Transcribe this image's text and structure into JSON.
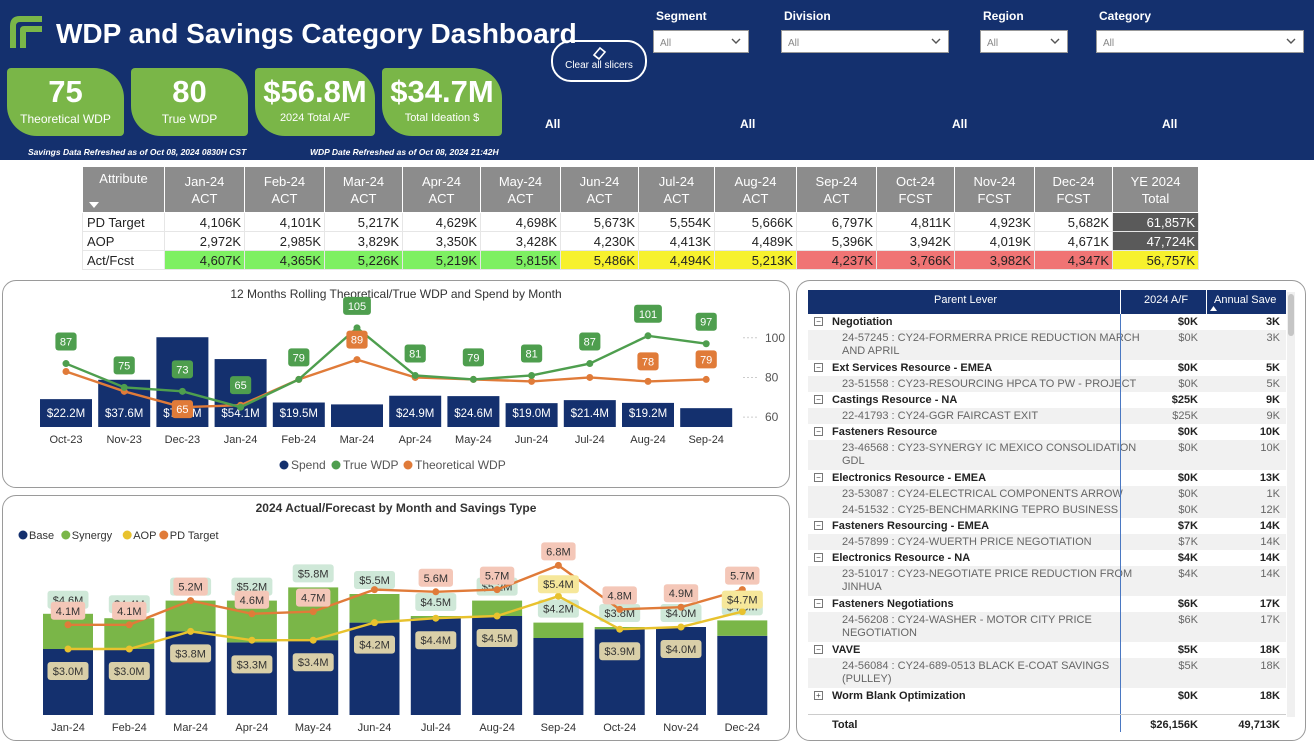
{
  "header": {
    "title": "WDP and Savings Category Dashboard",
    "clear_slicers_label": "Clear all slicers",
    "savings_refresh": "Savings Data Refreshed as of Oct 08, 2024 0830H CST",
    "wdp_refresh": "WDP Date Refreshed as of Oct 08, 2024 21:42H",
    "colors": {
      "header_bg": "#14306e",
      "kpi_green": "#7ab648"
    }
  },
  "kpis": [
    {
      "value": "75",
      "label": "Theoretical WDP"
    },
    {
      "value": "80",
      "label": "True WDP"
    },
    {
      "value": "$56.8M",
      "label": "2024 Total A/F"
    },
    {
      "value": "$34.7M",
      "label": "Total Ideation $"
    }
  ],
  "slicers": [
    {
      "label": "Segment",
      "value": "All",
      "selected": "All"
    },
    {
      "label": "Division",
      "value": "All",
      "selected": "All"
    },
    {
      "label": "Region",
      "value": "All",
      "selected": "All"
    },
    {
      "label": "Category",
      "value": "All",
      "selected": "All"
    }
  ],
  "matrix": {
    "attr_header": "Attribute",
    "columns": [
      [
        "Jan-24",
        "ACT"
      ],
      [
        "Feb-24",
        "ACT"
      ],
      [
        "Mar-24",
        "ACT"
      ],
      [
        "Apr-24",
        "ACT"
      ],
      [
        "May-24",
        "ACT"
      ],
      [
        "Jun-24",
        "ACT"
      ],
      [
        "Jul-24",
        "ACT"
      ],
      [
        "Aug-24",
        "ACT"
      ],
      [
        "Sep-24",
        "ACT"
      ],
      [
        "Oct-24",
        "FCST"
      ],
      [
        "Nov-24",
        "FCST"
      ],
      [
        "Dec-24",
        "FCST"
      ],
      [
        "YE 2024",
        "Total"
      ]
    ],
    "rows": [
      {
        "label": "PD Target",
        "values": [
          "4,106K",
          "4,101K",
          "5,217K",
          "4,629K",
          "4,698K",
          "5,673K",
          "5,554K",
          "5,666K",
          "6,797K",
          "4,811K",
          "4,923K",
          "5,682K",
          "61,857K"
        ]
      },
      {
        "label": "AOP",
        "values": [
          "2,972K",
          "2,985K",
          "3,829K",
          "3,350K",
          "3,428K",
          "4,230K",
          "4,413K",
          "4,489K",
          "5,396K",
          "3,942K",
          "4,019K",
          "4,671K",
          "47,724K"
        ]
      },
      {
        "label": "Act/Fcst",
        "values": [
          "4,607K",
          "4,365K",
          "5,226K",
          "5,219K",
          "5,815K",
          "5,486K",
          "4,494K",
          "5,213K",
          "4,237K",
          "3,766K",
          "3,982K",
          "4,347K",
          "56,757K"
        ]
      }
    ],
    "status_colors": {
      "green": "#7ef062",
      "yellow": "#f7f12d",
      "red": "#f07474",
      "total_bg": "#5a5a5a"
    }
  },
  "chart_data": [
    {
      "type": "bar",
      "title": "12 Months Rolling Theoretical/True WDP and Spend by Month",
      "categories": [
        "Oct-23",
        "Nov-23",
        "Dec-23",
        "Jan-24",
        "Feb-24",
        "Mar-24",
        "Apr-24",
        "May-24",
        "Jun-24",
        "Jul-24",
        "Aug-24",
        "Sep-24"
      ],
      "series": [
        {
          "name": "Spend",
          "type": "bar",
          "color": "#14306e",
          "values": [
            22.2,
            37.6,
            71.5,
            54.1,
            19.5,
            18.0,
            24.9,
            24.6,
            19.0,
            21.4,
            19.2,
            15.0
          ],
          "labels": [
            "$22.2M",
            "$37.6M",
            "$71.5M",
            "$54.1M",
            "$19.5M",
            "",
            "$24.9M",
            "$24.6M",
            "$19.0M",
            "$21.4M",
            "$19.2M",
            ""
          ]
        },
        {
          "name": "True WDP",
          "type": "line",
          "color": "#4e9e4e",
          "values": [
            87,
            75,
            73,
            65,
            79,
            105,
            81,
            79,
            81,
            87,
            101,
            97
          ]
        },
        {
          "name": "Theoretical WDP",
          "type": "line",
          "color": "#e07b39",
          "values": [
            83,
            73,
            65,
            66,
            79,
            89,
            80,
            79,
            78,
            80,
            78,
            79
          ],
          "labels": [
            "",
            "",
            "65",
            "",
            "",
            "89",
            "",
            "",
            "",
            "",
            "78",
            "79"
          ]
        }
      ],
      "y2_ticks": [
        "60",
        "80",
        "100"
      ],
      "y2lim": [
        55,
        112
      ]
    },
    {
      "type": "bar",
      "title": "2024 Actual/Forecast by Month and Savings Type",
      "categories": [
        "Jan-24",
        "Feb-24",
        "Mar-24",
        "Apr-24",
        "May-24",
        "Jun-24",
        "Jul-24",
        "Aug-24",
        "Sep-24",
        "Oct-24",
        "Nov-24",
        "Dec-24"
      ],
      "series": [
        {
          "name": "Base",
          "type": "bar",
          "color": "#14306e",
          "values": [
            3.0,
            3.0,
            3.8,
            3.3,
            3.4,
            4.2,
            4.4,
            4.5,
            3.5,
            3.9,
            4.0,
            3.6
          ],
          "labels": [
            "$3.0M",
            "$3.0M",
            "$3.8M",
            "$3.3M",
            "$3.4M",
            "$4.2M",
            "$4.4M",
            "$4.5M",
            "",
            "$3.9M",
            "$4.0M",
            ""
          ]
        },
        {
          "name": "Synergy",
          "type": "bar",
          "color": "#7ab648",
          "values": [
            1.6,
            1.4,
            1.4,
            1.9,
            2.4,
            1.3,
            0.1,
            0.7,
            0.7,
            0.1,
            0.0,
            0.7
          ],
          "total_labels": [
            "$4.6M",
            "$4.4M",
            "$5.2M",
            "$5.2M",
            "$5.8M",
            "$5.5M",
            "$4.5M",
            "$5.2M",
            "$4.2M",
            "$3.8M",
            "$4.0M",
            "$4.3M"
          ]
        },
        {
          "name": "AOP",
          "type": "line",
          "color": "#e8c22e",
          "values": [
            3.0,
            3.0,
            3.8,
            3.4,
            3.4,
            4.2,
            4.4,
            4.5,
            5.4,
            3.9,
            4.0,
            4.7
          ],
          "labels": [
            "",
            "",
            "",
            "",
            "",
            "",
            "",
            "",
            "$5.4M",
            "",
            "",
            "$4.7M"
          ]
        },
        {
          "name": "PD Target",
          "type": "line",
          "color": "#e07b39",
          "values": [
            4.1,
            4.1,
            5.2,
            4.6,
            4.7,
            5.7,
            5.6,
            5.7,
            6.8,
            4.8,
            4.9,
            5.7
          ],
          "labels": [
            "4.1M",
            "4.1M",
            "5.2M",
            "4.6M",
            "4.7M",
            "",
            "5.6M",
            "5.7M",
            "6.8M",
            "4.8M",
            "4.9M",
            "5.7M"
          ]
        }
      ],
      "ylim": [
        0,
        7.5
      ]
    }
  ],
  "lever_table": {
    "headers": {
      "lever": "Parent Lever",
      "af": "2024 A/F",
      "annual": "Annual Save"
    },
    "rows": [
      {
        "kind": "grp",
        "label": "Negotiation",
        "af": "$0K",
        "annual": "3K"
      },
      {
        "kind": "itm",
        "label": "24-57245 : CY24-FORMERRA PRICE REDUCTION MARCH",
        "label2": "AND APRIL",
        "af": "$0K",
        "annual": "3K"
      },
      {
        "kind": "grp",
        "label": "Ext Services Resource - EMEA",
        "af": "$0K",
        "annual": "5K"
      },
      {
        "kind": "itm",
        "label": "23-51558 : CY23-RESOURCING HPCA TO PW - PROJECT",
        "af": "$0K",
        "annual": "5K"
      },
      {
        "kind": "grp",
        "label": "Castings Resource - NA",
        "af": "$25K",
        "annual": "9K"
      },
      {
        "kind": "itm",
        "label": "22-41793 : CY24-GGR FAIRCAST EXIT",
        "af": "$25K",
        "annual": "9K"
      },
      {
        "kind": "grp",
        "label": "Fasteners Resource",
        "af": "$0K",
        "annual": "10K"
      },
      {
        "kind": "itm",
        "label": "23-46568 : CY23-SYNERGY IC MEXICO CONSOLIDATION",
        "label2": "GDL",
        "af": "$0K",
        "annual": "10K"
      },
      {
        "kind": "grp",
        "label": "Electronics Resource - EMEA",
        "af": "$0K",
        "annual": "13K"
      },
      {
        "kind": "itm",
        "label": "23-53087 : CY24-ELECTRICAL COMPONENTS ARROW",
        "af": "$0K",
        "annual": "1K"
      },
      {
        "kind": "itm",
        "label": "24-51532 : CY25-BENCHMARKING TEPRO BUSINESS",
        "af": "$0K",
        "annual": "12K"
      },
      {
        "kind": "grp",
        "label": "Fasteners Resourcing - EMEA",
        "af": "$7K",
        "annual": "14K"
      },
      {
        "kind": "itm",
        "label": "24-57899 : CY24-WUERTH PRICE NEGOTIATION",
        "af": "$7K",
        "annual": "14K"
      },
      {
        "kind": "grp",
        "label": "Electronics Resource - NA",
        "af": "$4K",
        "annual": "14K"
      },
      {
        "kind": "itm",
        "label": "23-51017 : CY23-NEGOTIATE PRICE REDUCTION FROM",
        "label2": "JINHUA",
        "af": "$4K",
        "annual": "14K"
      },
      {
        "kind": "grp",
        "label": "Fasteners Negotiations",
        "af": "$6K",
        "annual": "17K"
      },
      {
        "kind": "itm",
        "label": "24-56208 : CY24-WASHER - MOTOR CITY PRICE",
        "label2": "NEGOTIATION",
        "af": "$6K",
        "annual": "17K"
      },
      {
        "kind": "grp",
        "label": "VAVE",
        "af": "$5K",
        "annual": "18K"
      },
      {
        "kind": "itm",
        "label": "24-56084 : CY24-689-0513 BLACK E-COAT SAVINGS",
        "label2": "(PULLEY)",
        "af": "$5K",
        "annual": "18K"
      },
      {
        "kind": "grpc",
        "label": "Worm Blank Optimization",
        "af": "$0K",
        "annual": "18K"
      }
    ],
    "total": {
      "label": "Total",
      "af": "$26,156K",
      "annual": "49,713K"
    }
  }
}
